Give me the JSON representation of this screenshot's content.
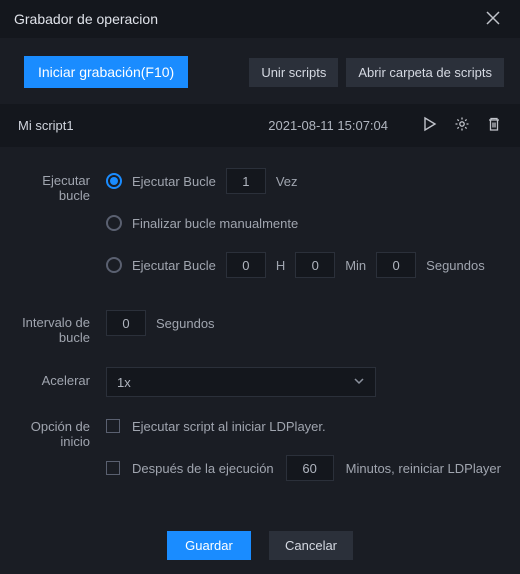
{
  "window": {
    "title": "Grabador de operacion"
  },
  "top": {
    "start_btn": "Iniciar grabación(F10)",
    "merge_btn": "Unir scripts",
    "open_folder_btn": "Abrir carpeta de scripts"
  },
  "script": {
    "name": "Mi script1",
    "date": "2021-08-11 15:07:04"
  },
  "loop": {
    "label": "Ejecutar bucle",
    "opt_times_prefix": "Ejecutar Bucle",
    "opt_times_value": "1",
    "opt_times_suffix": "Vez",
    "opt_manual": "Finalizar bucle manualmente",
    "opt_duration_prefix": "Ejecutar Bucle",
    "opt_h_value": "0",
    "opt_h_unit": "H",
    "opt_m_value": "0",
    "opt_m_unit": "Min",
    "opt_s_value": "0",
    "opt_s_unit": "Segundos"
  },
  "interval": {
    "label": "Intervalo de bucle",
    "value": "0",
    "unit": "Segundos"
  },
  "accel": {
    "label": "Acelerar",
    "value": "1x"
  },
  "startup": {
    "label": "Opción de inicio",
    "check_on_start": "Ejecutar script al iniciar LDPlayer.",
    "check_restart_prefix": "Después de la ejecución",
    "check_restart_value": "60",
    "check_restart_suffix": "Minutos, reiniciar LDPlayer"
  },
  "dialog": {
    "save": "Guardar",
    "cancel": "Cancelar"
  }
}
